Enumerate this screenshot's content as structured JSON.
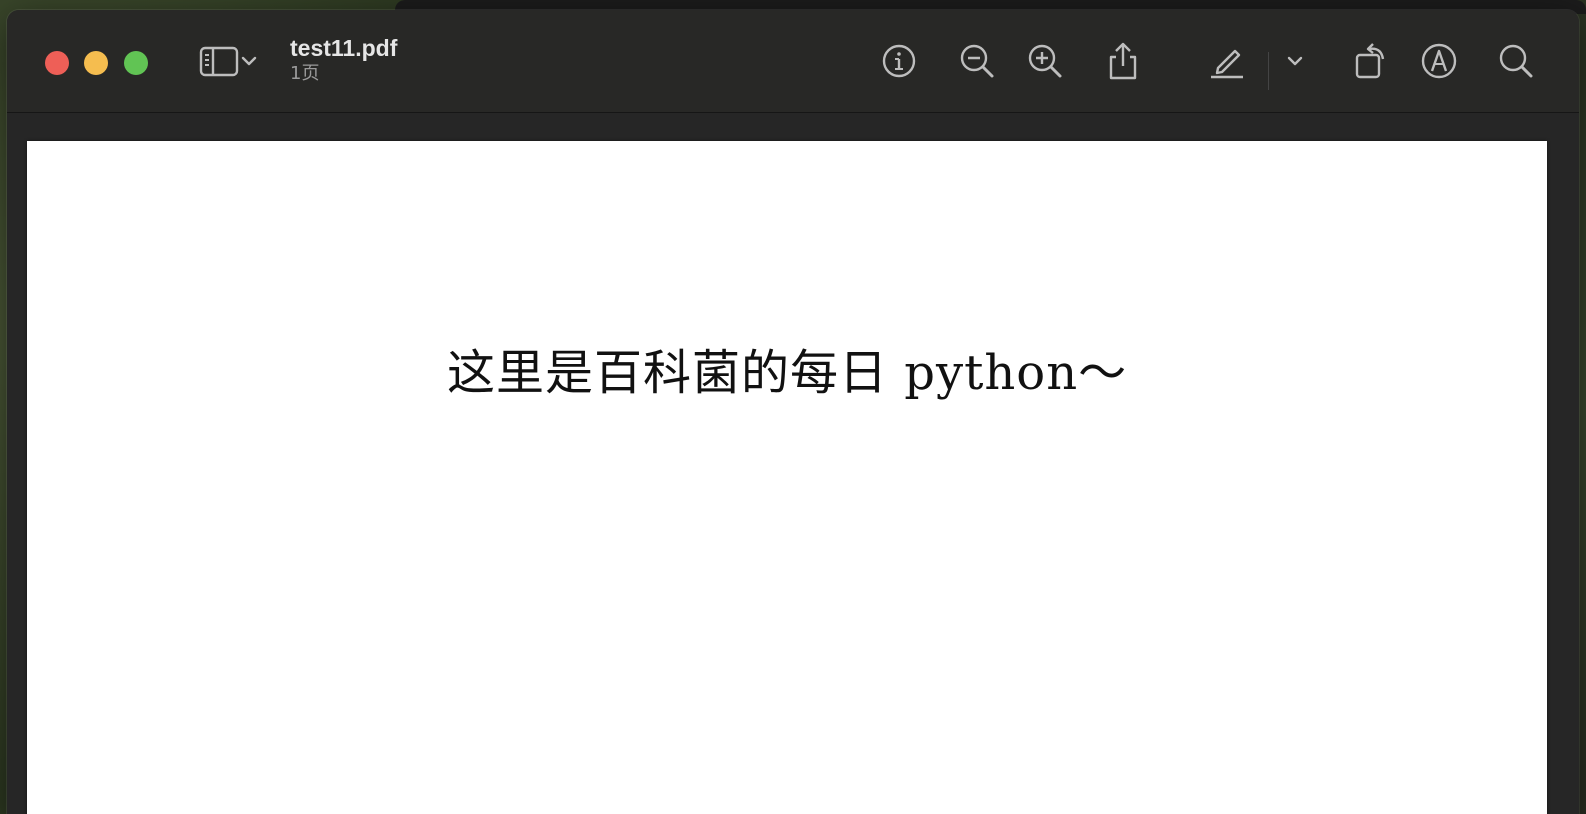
{
  "window": {
    "title": "test11.pdf",
    "subtitle": "1页"
  },
  "toolbar": {
    "buttons": [
      {
        "name": "sidebar-toggle",
        "icon": "sidebar-icon"
      },
      {
        "name": "sidebar-options",
        "icon": "chevron-down-icon"
      },
      {
        "name": "info",
        "icon": "info-icon"
      },
      {
        "name": "zoom-out",
        "icon": "zoom-out-icon"
      },
      {
        "name": "zoom-in",
        "icon": "zoom-in-icon"
      },
      {
        "name": "share",
        "icon": "share-icon"
      },
      {
        "name": "highlight",
        "icon": "pencil-icon"
      },
      {
        "name": "highlight-options",
        "icon": "chevron-down-icon"
      },
      {
        "name": "rotate",
        "icon": "rotate-icon"
      },
      {
        "name": "markup",
        "icon": "markup-icon"
      },
      {
        "name": "search",
        "icon": "search-icon"
      }
    ]
  },
  "document": {
    "text": "这里是百科菌的每日 python～"
  },
  "colors": {
    "close": "#ee5f57",
    "minimize": "#f5bd4f",
    "maximize": "#61c454",
    "toolbar_bg": "#282826",
    "page_bg": "#ffffff"
  }
}
